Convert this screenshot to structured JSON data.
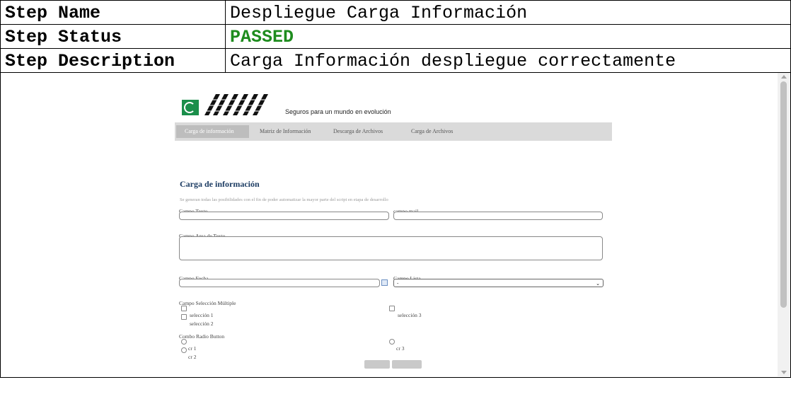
{
  "report": {
    "step_name_label": "Step Name",
    "step_name_value": "Despliegue Carga Información",
    "step_status_label": "Step Status",
    "step_status_value": "PASSED",
    "step_description_label": "Step Description",
    "step_description_value": "Carga Información despliegue correctamente",
    "colors": {
      "passed": "#1e8c1e",
      "border": "#000000"
    }
  },
  "app": {
    "tagline": "Seguros para un mundo en evolución",
    "nav": [
      "Carga de información",
      "Matriz de Información",
      "Descarga de Archivos",
      "Carga de Archivos"
    ],
    "active_tab": "Carga de información",
    "page_title": "Carga de información",
    "page_description": "Se generan todas las posibilidades con el fin de poder automatizar la mayor parte del script en etapa de desarrollo",
    "fields": {
      "campo_texto": "Campo Texto",
      "campo_mail": "campo mail",
      "campo_area": "Campo Area de Texto",
      "campo_fecha": "Campo Fecha",
      "campo_lista": "Campo Lista",
      "campo_lista_value": "-",
      "campo_seleccion": "Campo Selección Múltiple",
      "campo_radio": "Combo Radio Button"
    },
    "checkboxes": [
      "selección 1",
      "selección 2",
      "selección 3"
    ],
    "radios": [
      "cr 1",
      "cr 2",
      "cr 3"
    ],
    "colors": {
      "title": "#1c3c63",
      "nav_bg": "#dadada",
      "logo_green": "#1a8e4a"
    }
  }
}
